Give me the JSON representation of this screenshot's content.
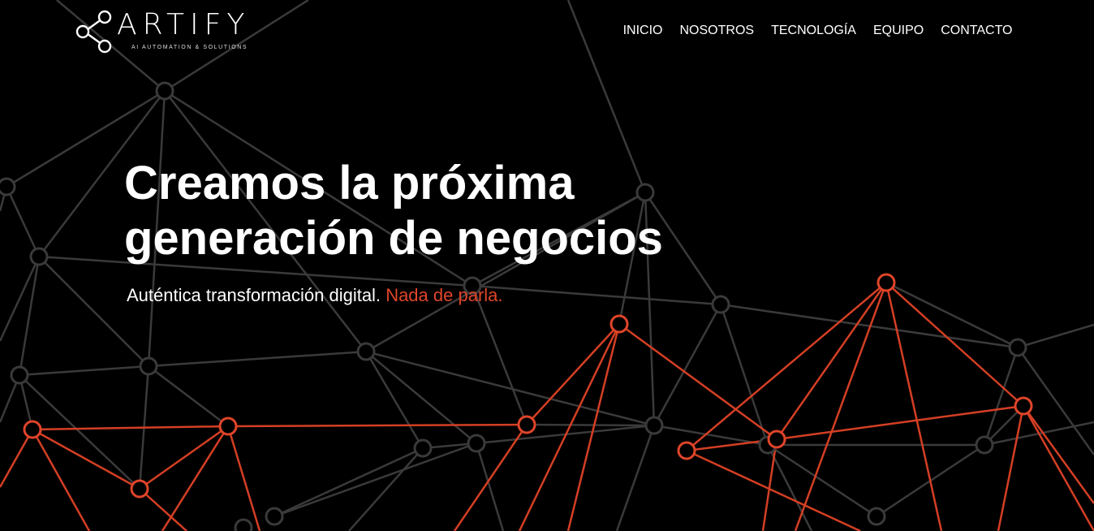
{
  "brand": {
    "name": "ARTIFY",
    "tagline": "AI AUTOMATION & SOLUTIONS",
    "logo_icon": "share-nodes-icon"
  },
  "nav": {
    "items": [
      {
        "label": "INICIO"
      },
      {
        "label": "NOSOTROS"
      },
      {
        "label": "TECNOLOGÍA"
      },
      {
        "label": "EQUIPO"
      },
      {
        "label": "CONTACTO"
      }
    ]
  },
  "hero": {
    "title_line1": "Creamos la próxima",
    "title_line2": "generación de negocios",
    "subtitle_main": "Auténtica transformación digital.",
    "subtitle_accent": "Nada de parla."
  },
  "colors": {
    "background": "#000000",
    "accent": "#e0452a",
    "network_gray": "#3a3a3a",
    "text": "#ffffff"
  }
}
